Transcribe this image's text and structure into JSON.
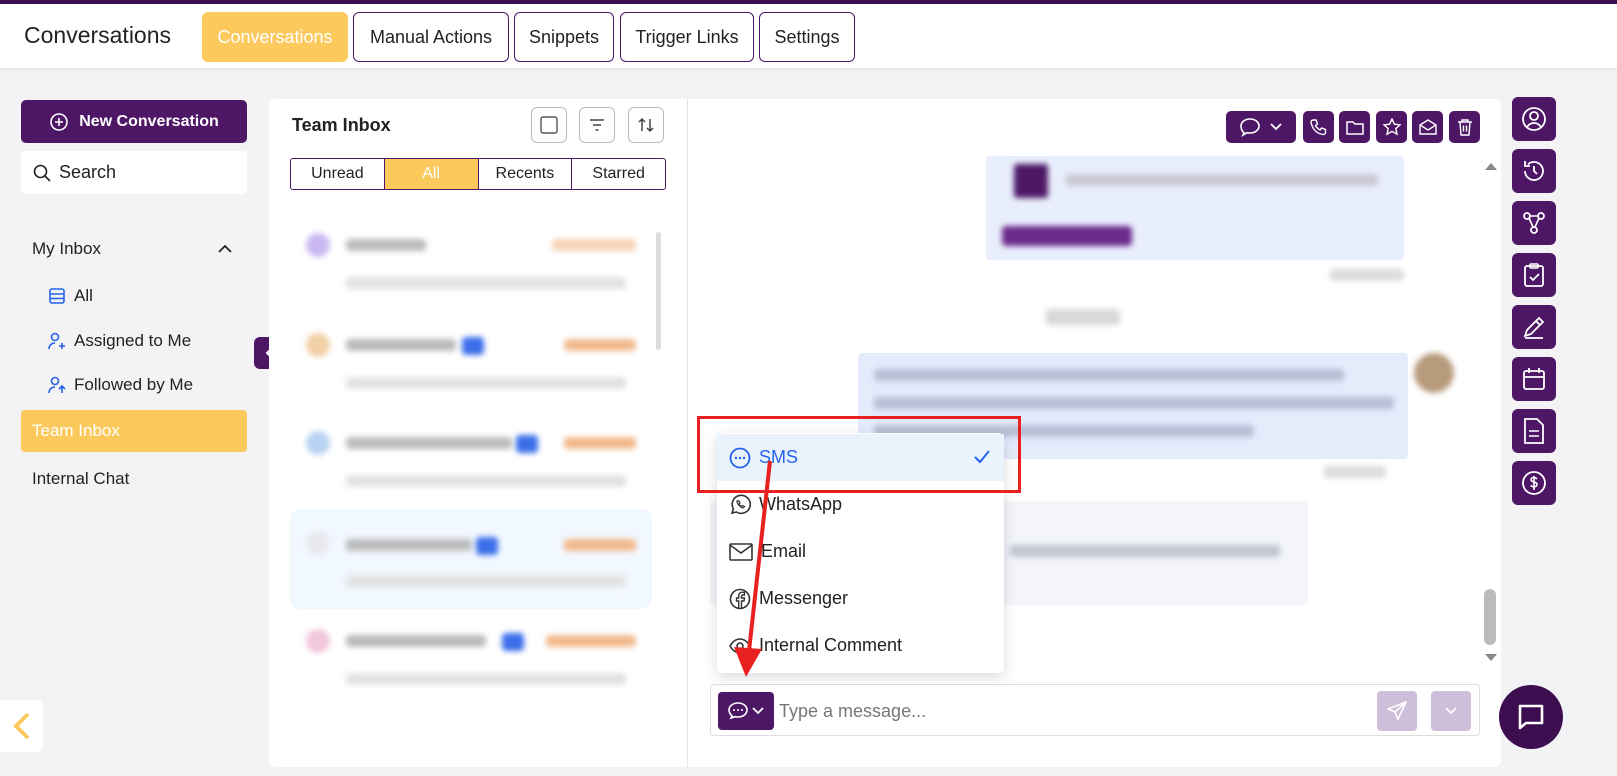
{
  "app": {
    "title": "Conversations"
  },
  "tabs": [
    {
      "label": "Conversations",
      "active": true
    },
    {
      "label": "Manual Actions"
    },
    {
      "label": "Snippets"
    },
    {
      "label": "Trigger Links"
    },
    {
      "label": "Settings"
    }
  ],
  "sidebar": {
    "new_conversation_label": "New Conversation",
    "search_placeholder": "Search",
    "my_inbox_label": "My Inbox",
    "items": [
      {
        "label": "All",
        "icon": "list-icon"
      },
      {
        "label": "Assigned to Me",
        "icon": "user-assigned-icon"
      },
      {
        "label": "Followed by Me",
        "icon": "user-followed-icon"
      }
    ],
    "team_inbox_label": "Team Inbox",
    "internal_chat_label": "Internal Chat"
  },
  "inbox": {
    "title": "Team Inbox",
    "filters": [
      "Unread",
      "All",
      "Recents",
      "Starred"
    ],
    "active_filter": "All"
  },
  "composer": {
    "placeholder": "Type a message..."
  },
  "channel_menu": {
    "options": [
      {
        "label": "SMS",
        "icon": "chat-bubble-icon",
        "selected": true
      },
      {
        "label": "WhatsApp",
        "icon": "whatsapp-icon"
      },
      {
        "label": "Email",
        "icon": "mail-icon"
      },
      {
        "label": "Messenger",
        "icon": "facebook-icon"
      },
      {
        "label": "Internal Comment",
        "icon": "eye-icon"
      }
    ]
  },
  "colors": {
    "brand": "#4d1766",
    "accent": "#fcc95d",
    "annotation": "#e8201f"
  }
}
